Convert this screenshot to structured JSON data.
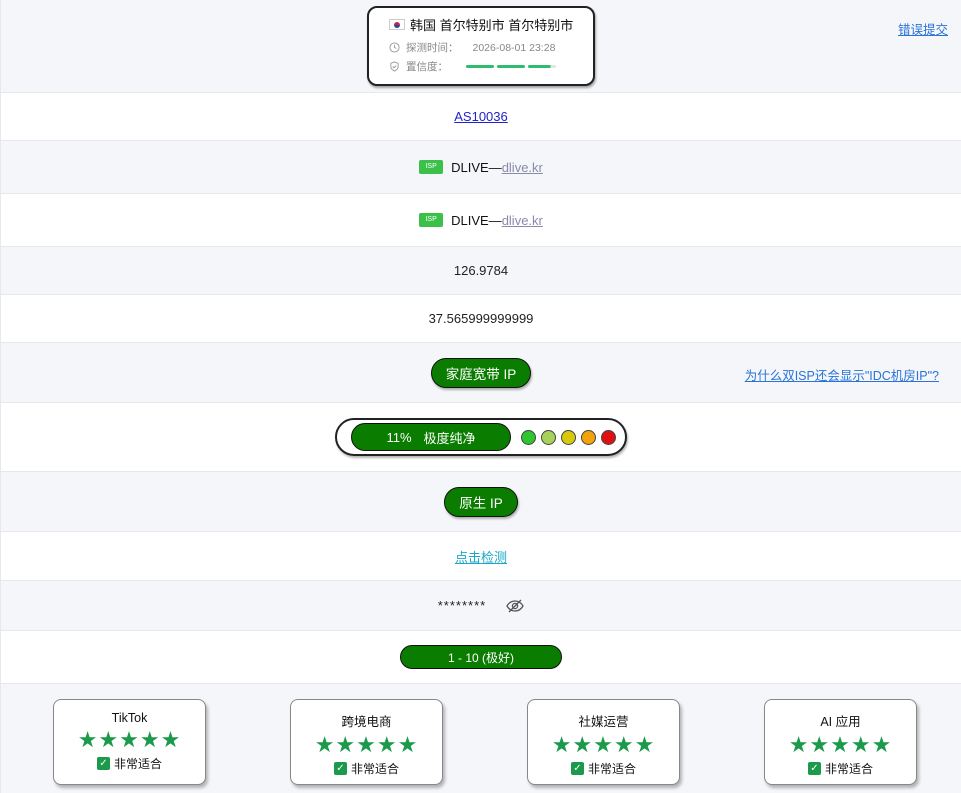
{
  "location": {
    "flag": "korea-flag-icon",
    "place": "韩国 首尔特别市 首尔特别市",
    "time_label": "探测时间：",
    "time_value": "2026-08-01 23:28",
    "confidence_label": "置信度：",
    "confidence_level": 0.95
  },
  "report_error": "错误提交",
  "asn": "AS10036",
  "isp_rows": [
    {
      "tag": "ISP",
      "name": "DLIVE— ",
      "link": "dlive.kr"
    },
    {
      "tag": "ISP",
      "name": "DLIVE— ",
      "link": "dlive.kr"
    }
  ],
  "longitude": "126.9784",
  "latitude": "37.565999999999",
  "ip_type": {
    "label": "家庭宽带 IP",
    "help_link": "为什么双ISP还会显示\"IDC机房IP\"?"
  },
  "risk": {
    "percent": "11%",
    "label": "极度纯净",
    "dot_colors": [
      "#2ec52e",
      "#a6d25a",
      "#d8c80c",
      "#f2a20a",
      "#e01010"
    ]
  },
  "native": "原生 IP",
  "detect_link": "点击检测",
  "masked_value": "********",
  "score": "1 - 10 (极好)",
  "colors": {
    "accent_green": "#0a7d00",
    "star_green": "#1a9a4a",
    "link_blue": "#2a73d8"
  },
  "usage_cards": [
    {
      "title": "TikTok",
      "stars": "★★★★★",
      "fit": "非常适合"
    },
    {
      "title": "跨境电商",
      "stars": "★★★★★",
      "fit": "非常适合"
    },
    {
      "title": "社媒运营",
      "stars": "★★★★★",
      "fit": "非常适合"
    },
    {
      "title": "AI 应用",
      "stars": "★★★★★",
      "fit": "非常适合"
    }
  ]
}
